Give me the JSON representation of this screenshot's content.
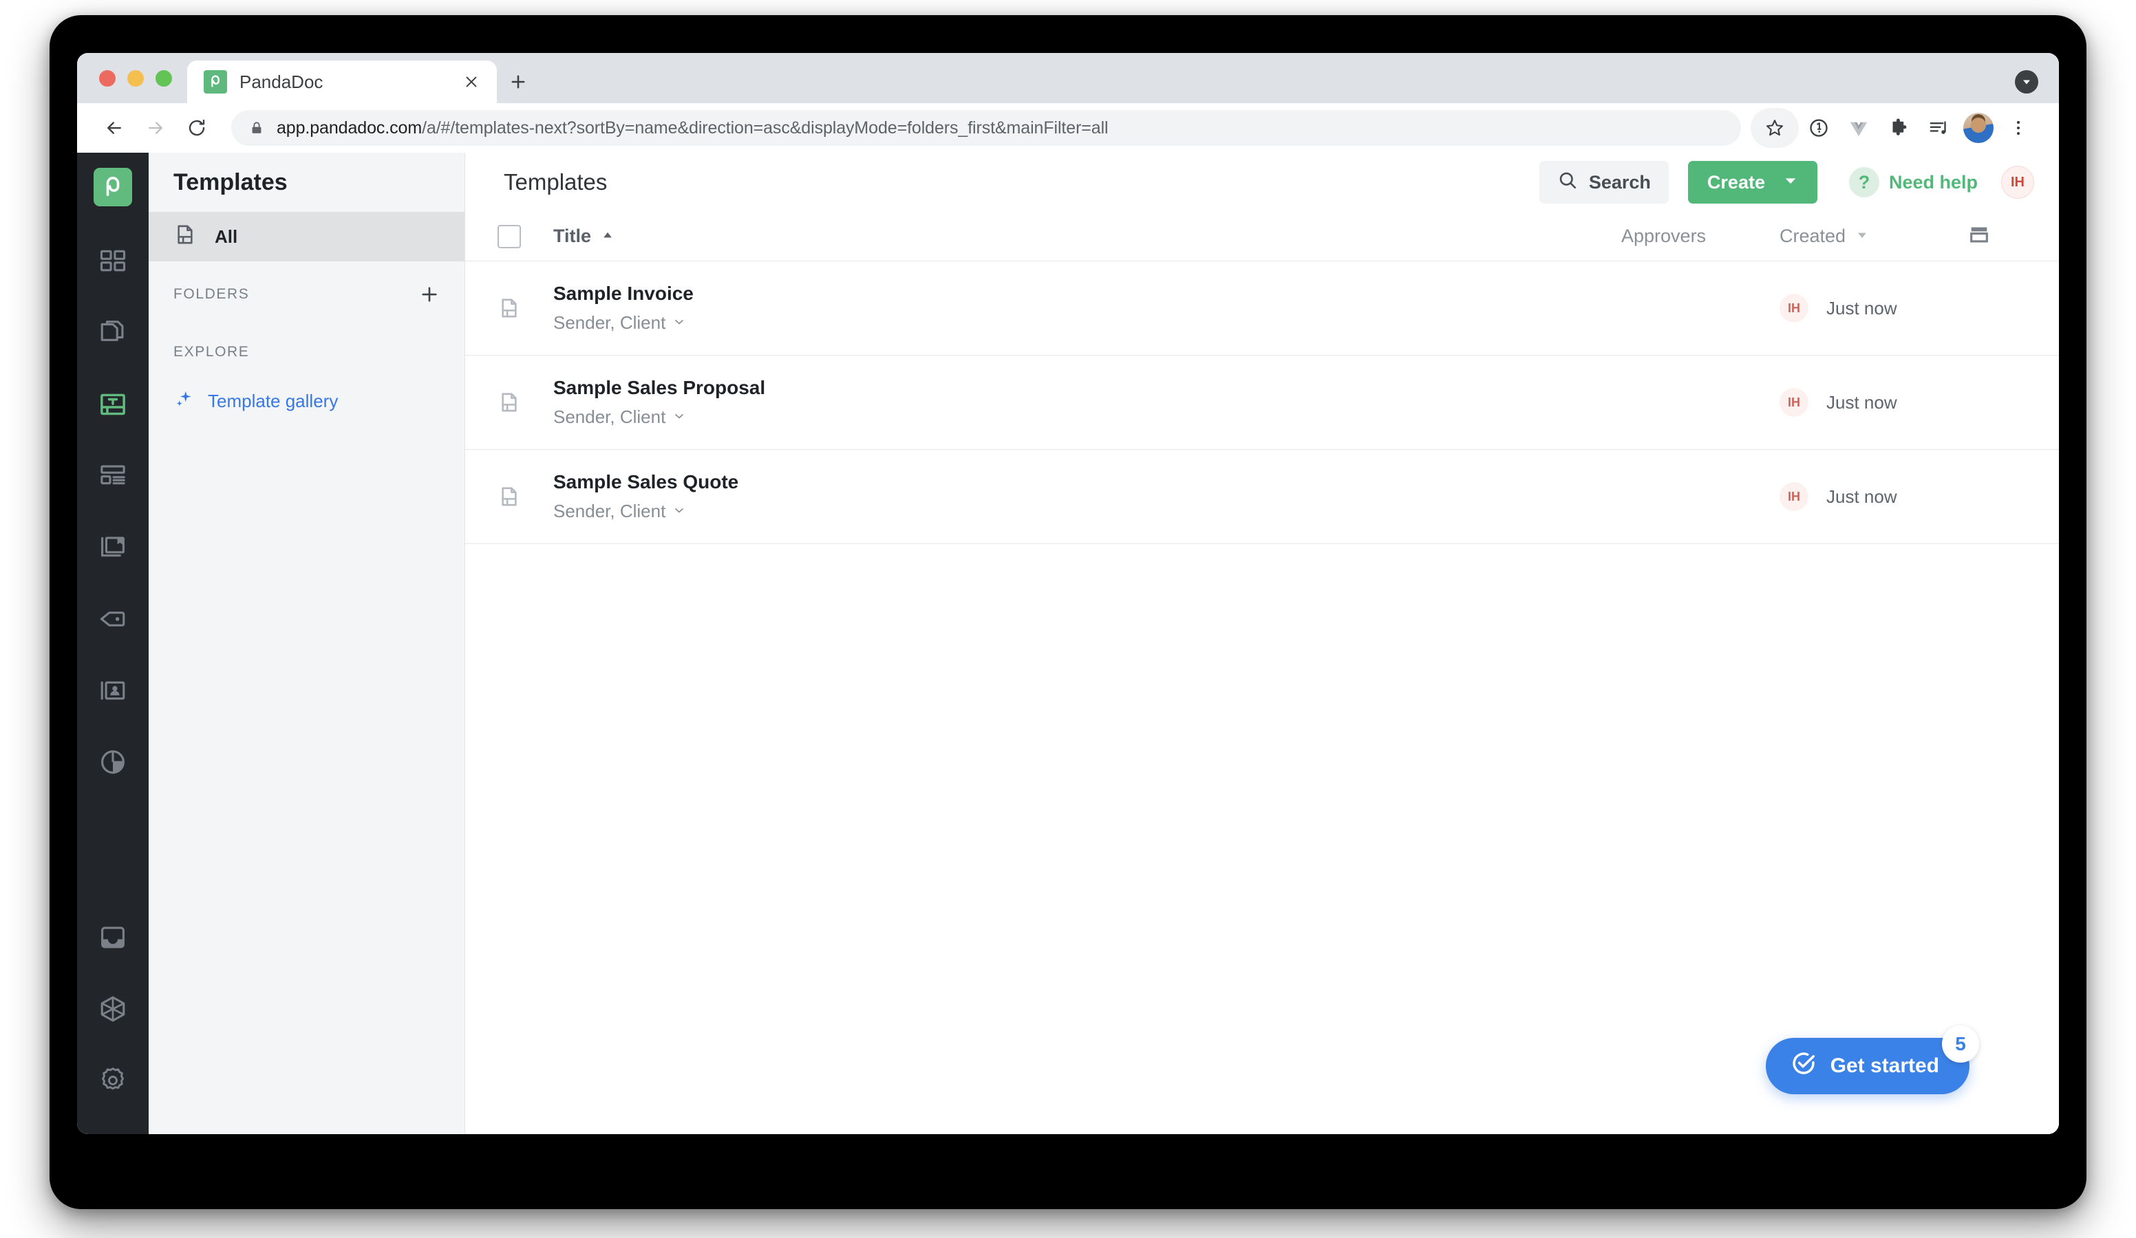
{
  "browser": {
    "tab": {
      "title": "PandaDoc",
      "favicon": "pandadoc-favicon",
      "close_label": "×"
    },
    "new_tab_label": "+",
    "tab_search_icon": "tab-search-icon",
    "url": {
      "domain": "app.pandadoc.com",
      "path": "/a/#/templates-next?sortBy=name&direction=asc&displayMode=folders_first&mainFilter=all",
      "full": "app.pandadoc.com/a/#/templates-next?sortBy=name&direction=asc&displayMode=folders_first&mainFilter=all",
      "secure": true
    },
    "toolbar_icons": [
      "back-icon",
      "forward-icon",
      "reload-icon",
      "lock-icon",
      "bookmark-star-icon",
      "onepassword-icon",
      "vue-devtools-icon",
      "extensions-puzzle-icon",
      "reading-list-icon",
      "profile-avatar-icon",
      "chrome-menu-icon"
    ]
  },
  "rail": {
    "logo": "pandadoc-logo",
    "items": [
      {
        "name": "dashboard",
        "icon": "dashboard-grid-icon",
        "active": false
      },
      {
        "name": "documents",
        "icon": "documents-icon",
        "active": false
      },
      {
        "name": "templates",
        "icon": "templates-icon",
        "active": true
      },
      {
        "name": "content-library",
        "icon": "content-library-icon",
        "active": false
      },
      {
        "name": "catalog",
        "icon": "catalog-image-icon",
        "active": false
      },
      {
        "name": "pricing-tables",
        "icon": "tag-icon",
        "active": false
      },
      {
        "name": "contacts",
        "icon": "contacts-card-icon",
        "active": false
      },
      {
        "name": "reports",
        "icon": "pie-chart-icon",
        "active": false
      }
    ],
    "bottom_items": [
      {
        "name": "inbox",
        "icon": "inbox-icon"
      },
      {
        "name": "integrations",
        "icon": "cube-icon"
      },
      {
        "name": "settings",
        "icon": "gear-icon"
      }
    ]
  },
  "sidebar": {
    "header": "Templates",
    "all_item": {
      "label": "All",
      "icon": "template-doc-icon",
      "selected": true
    },
    "folders_section": {
      "label": "FOLDERS",
      "add_icon": "plus-icon"
    },
    "explore_section": {
      "label": "EXPLORE"
    },
    "template_gallery": {
      "label": "Template gallery",
      "icon": "sparkle-icon"
    }
  },
  "main": {
    "title": "Templates",
    "search_button": {
      "label": "Search",
      "icon": "search-icon"
    },
    "create_button": {
      "label": "Create",
      "icon": "chevron-down-icon"
    },
    "need_help": {
      "label": "Need help",
      "icon": "question-mark-icon"
    },
    "user_badge": {
      "initials": "IH"
    }
  },
  "table": {
    "columns": {
      "title": "Title",
      "title_sort": "▲",
      "approvers": "Approvers",
      "created": "Created",
      "created_sort": "▼",
      "settings_icon": "layout-density-icon"
    },
    "select_all_checkbox": "unchecked",
    "rows": [
      {
        "icon": "template-doc-icon",
        "title": "Sample Invoice",
        "roles": "Sender, Client",
        "roles_chevron": "chevron-down-icon",
        "approvers": "",
        "creator_initials": "IH",
        "created": "Just now"
      },
      {
        "icon": "template-doc-icon",
        "title": "Sample Sales Proposal",
        "roles": "Sender, Client",
        "roles_chevron": "chevron-down-icon",
        "approvers": "",
        "creator_initials": "IH",
        "created": "Just now"
      },
      {
        "icon": "template-doc-icon",
        "title": "Sample Sales Quote",
        "roles": "Sender, Client",
        "roles_chevron": "chevron-down-icon",
        "approvers": "",
        "creator_initials": "IH",
        "created": "Just now"
      }
    ]
  },
  "fab": {
    "label": "Get started",
    "icon": "check-circle-icon",
    "badge": "5"
  },
  "colors": {
    "brand_green": "#52b87a",
    "rail_dark": "#22262b",
    "link_blue": "#3778e8",
    "fab_blue": "#3b82e8",
    "avatar_red": "#c94a3b"
  }
}
